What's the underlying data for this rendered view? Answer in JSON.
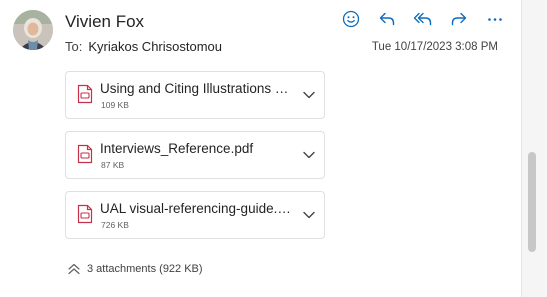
{
  "message": {
    "sender": "Vivien Fox",
    "to_label": "To:",
    "recipient": "Kyriakos Chrisostomou",
    "date": "Tue 10/17/2023 3:08 PM"
  },
  "actions": [
    {
      "icon": "emoji-icon"
    },
    {
      "icon": "reply-icon"
    },
    {
      "icon": "reply-all-icon"
    },
    {
      "icon": "forward-icon"
    },
    {
      "icon": "more-icon"
    }
  ],
  "attachments": [
    {
      "name": "Using and Citing Illustrations and Images.pdf",
      "size": "109 KB",
      "icon": "pdf-icon"
    },
    {
      "name": "Interviews_Reference.pdf",
      "size": "87 KB",
      "icon": "pdf-icon"
    },
    {
      "name": "UAL visual-referencing-guide.pdf",
      "size": "726 KB",
      "icon": "pdf-icon"
    }
  ],
  "summary": {
    "text": "3 attachments (922 KB)"
  },
  "colors": {
    "accent": "#0f6cbd",
    "pdf": "#c4314b"
  }
}
